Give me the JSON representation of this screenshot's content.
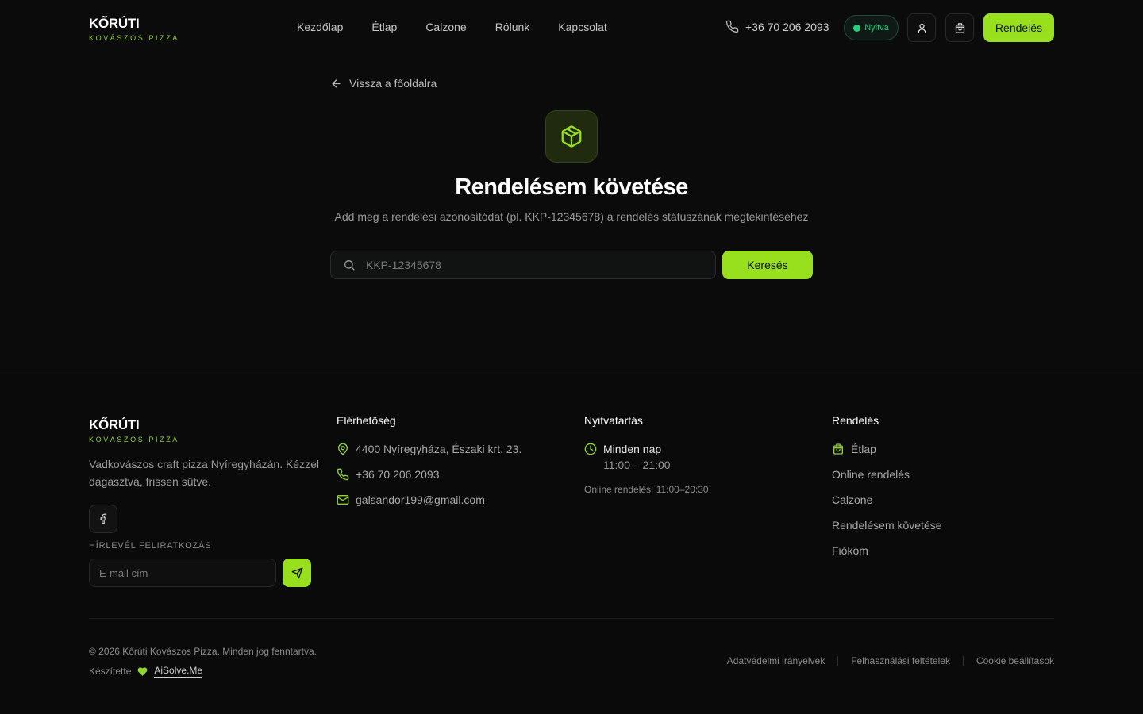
{
  "brand": {
    "name": "KŐRÚTI",
    "subtitle": "KOVÁSZOS PIZZA"
  },
  "nav": {
    "items": [
      {
        "label": "Kezdőlap"
      },
      {
        "label": "Étlap"
      },
      {
        "label": "Calzone"
      },
      {
        "label": "Rólunk"
      },
      {
        "label": "Kapcsolat"
      }
    ]
  },
  "header": {
    "phone": "+36 70 206 2093",
    "status": "Nyitva",
    "order_label": "Rendelés",
    "accent": "#98e01e",
    "status_color": "#1fcf7b"
  },
  "main": {
    "back_label": "Vissza a főoldalra",
    "hero_icon": "package-icon",
    "title": "Rendelésem követése",
    "subtitle": "Add meg a rendelési azonosítódat (pl. KKP-12345678) a rendelés státuszának megtekintéséhez",
    "search_placeholder": "KKP-12345678",
    "search_button": "Keresés"
  },
  "footer": {
    "brand_name": "KŐRÚTI",
    "brand_sub": "KOVÁSZOS PIZZA",
    "description": "Vadkovászos craft pizza Nyíregyházán. Kézzel dagasztva, frissen sütve.",
    "newsletter_label": "HÍRLEVÉL FELIRATKOZÁS",
    "newsletter_placeholder": "E-mail cím",
    "contact_title": "Elérhetőség",
    "address": "4400 Nyíregyháza, Északi krt. 23.",
    "phone": "+36 70 206 2093",
    "email": "galsandor199@gmail.com",
    "hours_title": "Nyitvatartás",
    "hours_days": "Minden nap",
    "hours_time": "11:00 – 21:00",
    "online_hours": "Online rendelés: 11:00–20:30",
    "order_title": "Rendelés",
    "order_links": [
      {
        "label": "Étlap"
      },
      {
        "label": "Online rendelés"
      },
      {
        "label": "Calzone"
      },
      {
        "label": "Rendelésem követése"
      },
      {
        "label": "Fiókom"
      }
    ],
    "copyright": "© 2026 Kőrúti Kovászos Pizza. Minden jog fenntartva.",
    "made_by_label": "Készítette",
    "made_by_link": "AiSolve.Me",
    "legal": [
      {
        "label": "Adatvédelmi irányelvek"
      },
      {
        "label": "Felhasználási feltételek"
      },
      {
        "label": "Cookie beállítások"
      }
    ]
  }
}
